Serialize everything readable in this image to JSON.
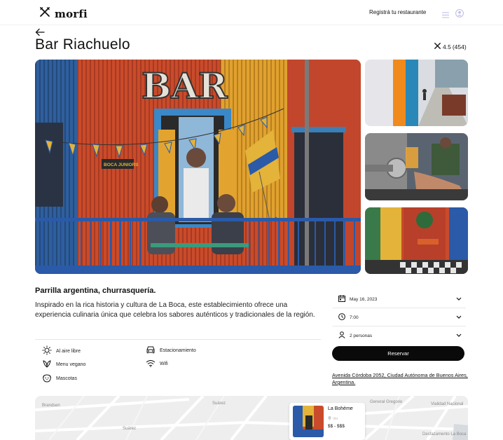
{
  "brand": {
    "name": "morfi"
  },
  "header": {
    "register_label": "Registrá tu restaurante"
  },
  "restaurant": {
    "name": "Bar Riachuelo",
    "rating": "4.5",
    "reviews": "(454)",
    "subtitle": "Parrilla argentina, churrasquería.",
    "description": "Inspirado en la rica historia y cultura de La Boca, este establecimiento ofrece una experiencia culinaria única que celebra los sabores auténticos y tradicionales de la región.",
    "address": "Avenida Córdoba 2052, Ciudad Autónoma de Buenos Aires, Argentina."
  },
  "hero": {
    "sign_text": "BAR",
    "banner_text": "BOCA JUNIORS"
  },
  "amenities": [
    {
      "label": "Al aire libre",
      "icon": "sun-icon"
    },
    {
      "label": "Estacionamiento",
      "icon": "car-icon"
    },
    {
      "label": "Menu vegano",
      "icon": "leaf-icon"
    },
    {
      "label": "Wifi",
      "icon": "wifi-icon"
    },
    {
      "label": "Mascotas",
      "icon": "dog-icon"
    }
  ],
  "reservation": {
    "date": "May 16, 2023",
    "time": "7:00",
    "people": "2 personas",
    "button_label": "Reservar"
  },
  "map": {
    "streets": [
      "Brandsen",
      "Suárez",
      "Suárez",
      "General Gregorio",
      "Vialidad Nacional",
      "Desfazamento La Boca"
    ],
    "card": {
      "name": "La Bohème",
      "location": "Ver",
      "price": "$$ - $$$"
    }
  },
  "colors": {
    "accent": "#0a0a0a",
    "zinc_orange": "#d9552c",
    "boca_blue": "#2a5aa8",
    "boca_yellow": "#e8b33a"
  }
}
